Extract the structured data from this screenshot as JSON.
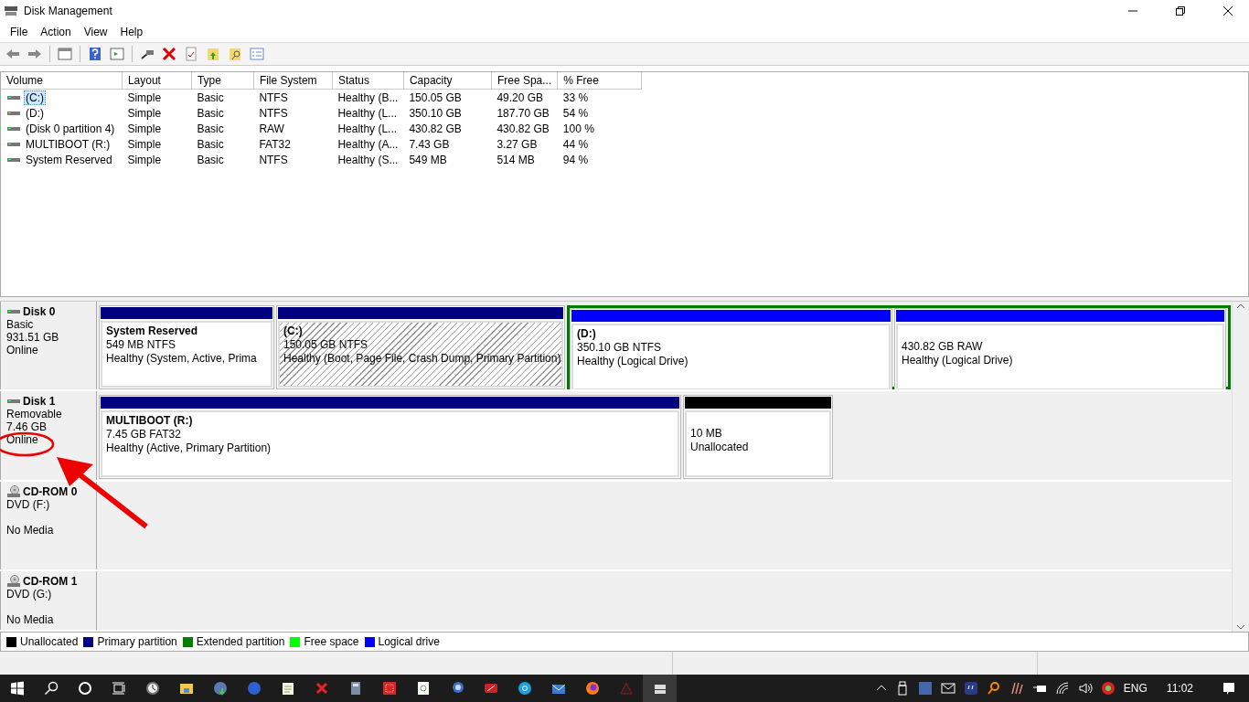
{
  "window": {
    "title": "Disk Management"
  },
  "menu": [
    "File",
    "Action",
    "View",
    "Help"
  ],
  "volume_table": {
    "columns": [
      "Volume",
      "Layout",
      "Type",
      "File System",
      "Status",
      "Capacity",
      "Free Spa...",
      "% Free"
    ],
    "rows": [
      {
        "selected": true,
        "cells": [
          "(C:)",
          "Simple",
          "Basic",
          "NTFS",
          "Healthy (B...",
          "150.05 GB",
          "49.20 GB",
          "33 %"
        ]
      },
      {
        "selected": false,
        "cells": [
          " (D:)",
          "Simple",
          "Basic",
          "NTFS",
          "Healthy (L...",
          "350.10 GB",
          "187.70 GB",
          "54 %"
        ]
      },
      {
        "selected": false,
        "cells": [
          "(Disk 0 partition 4)",
          "Simple",
          "Basic",
          "RAW",
          "Healthy (L...",
          "430.82 GB",
          "430.82 GB",
          "100 %"
        ]
      },
      {
        "selected": false,
        "cells": [
          "MULTIBOOT (R:)",
          "Simple",
          "Basic",
          "FAT32",
          "Healthy (A...",
          "7.43 GB",
          "3.27 GB",
          "44 %"
        ]
      },
      {
        "selected": false,
        "cells": [
          "System Reserved",
          "Simple",
          "Basic",
          "NTFS",
          "Healthy (S...",
          "549 MB",
          "514 MB",
          "94 %"
        ]
      }
    ]
  },
  "disks": [
    {
      "kind": "disk",
      "name": "Disk 0",
      "type": "Basic",
      "size": "931.51 GB",
      "status": "Online",
      "partitions": [
        {
          "kind": "primary",
          "selected": false,
          "name": "System Reserved",
          "detail": "549 MB NTFS",
          "health": "Healthy (System, Active, Prima"
        },
        {
          "kind": "primary",
          "selected": true,
          "name": "(C:)",
          "detail": "150.05 GB NTFS",
          "health": "Healthy (Boot, Page File, Crash Dump, Primary Partition)"
        },
        {
          "kind": "extended",
          "children": [
            {
              "kind": "logical",
              "selected": false,
              "name": "(D:)",
              "detail": "350.10 GB NTFS",
              "health": "Healthy (Logical Drive)"
            },
            {
              "kind": "logical",
              "selected": false,
              "detail": "430.82 GB RAW",
              "health": "Healthy (Logical Drive)"
            }
          ]
        }
      ]
    },
    {
      "kind": "disk",
      "name": "Disk 1",
      "type": "Removable",
      "size": "7.46 GB",
      "status": "Online",
      "partitions": [
        {
          "kind": "primary",
          "selected": false,
          "name": "MULTIBOOT  (R:)",
          "detail": "7.45 GB FAT32",
          "health": "Healthy (Active, Primary Partition)"
        },
        {
          "kind": "unallocated",
          "selected": false,
          "detail": "10 MB",
          "health": "Unallocated"
        }
      ]
    },
    {
      "kind": "cdrom",
      "name": "CD-ROM 0",
      "type": "DVD (F:)",
      "status": "No Media"
    },
    {
      "kind": "cdrom",
      "name": "CD-ROM 1",
      "type": "DVD (G:)",
      "status": "No Media"
    }
  ],
  "legend": [
    {
      "label": "Unallocated",
      "color": "#000000"
    },
    {
      "label": "Primary partition",
      "color": "#000080"
    },
    {
      "label": "Extended partition",
      "color": "#008000"
    },
    {
      "label": "Free space",
      "color": "#00ff00"
    },
    {
      "label": "Logical drive",
      "color": "#0000ff"
    }
  ],
  "tray": {
    "language": "ENG",
    "time": "11:02"
  }
}
